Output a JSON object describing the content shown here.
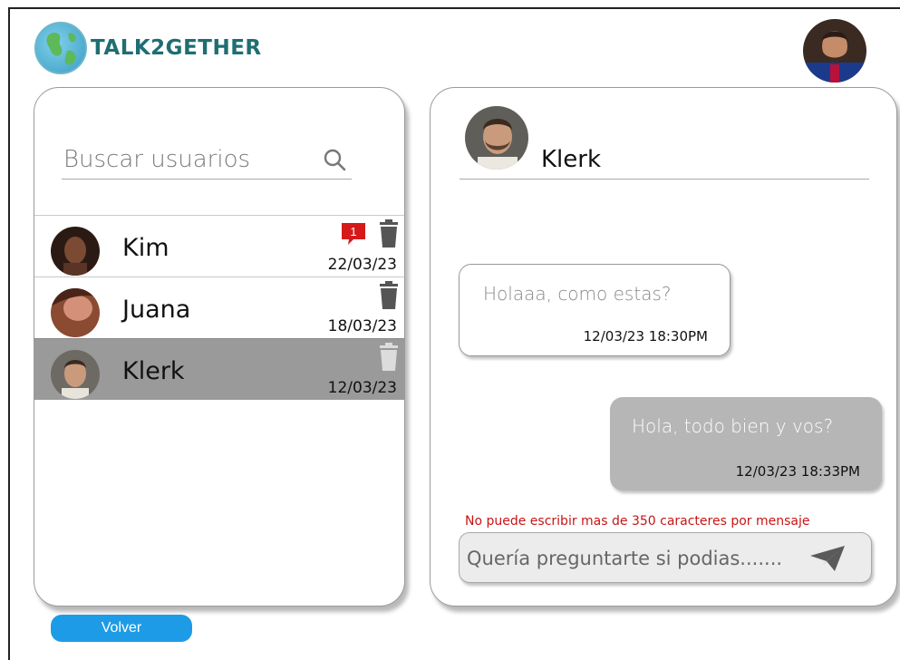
{
  "app": {
    "logo_text": "TALK2GETHER",
    "logo_icon": "globe-icon"
  },
  "header": {
    "user_avatar": "user-avatar"
  },
  "search": {
    "placeholder": "Buscar usuarios",
    "icon": "search-icon"
  },
  "contacts": [
    {
      "name": "Kim",
      "date": "22/03/23",
      "unread": "1",
      "active": false
    },
    {
      "name": "Juana",
      "date": "18/03/23",
      "unread": "",
      "active": false
    },
    {
      "name": "Klerk",
      "date": "12/03/23",
      "unread": "",
      "active": true
    }
  ],
  "chat": {
    "contact_name": "Klerk",
    "messages": [
      {
        "direction": "in",
        "text": "Holaaa, como estas?",
        "time": "12/03/23 18:30PM"
      },
      {
        "direction": "out",
        "text": "Hola, todo bien y vos?",
        "time": "12/03/23 18:33PM"
      }
    ],
    "warning": "No puede escribir mas de 350 caracteres por mensaje",
    "composer_value": "Quería preguntarte si podias......."
  },
  "footer": {
    "back_label": "Volver"
  },
  "colors": {
    "accent": "#1e9be6",
    "logo": "#1f6e72",
    "warning": "#c81414",
    "badge": "#d61a1a",
    "active_row": "#9a9a9a"
  }
}
